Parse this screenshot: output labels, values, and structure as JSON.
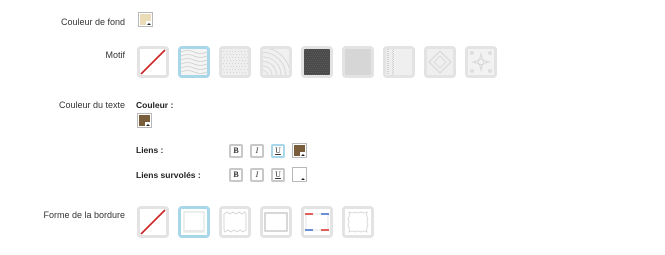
{
  "background": {
    "label": "Couleur de fond",
    "color": "#eadcb6"
  },
  "motif": {
    "label": "Motif",
    "selected_index": 1,
    "tiles": [
      {
        "name": "none",
        "icon": "none-slash-icon"
      },
      {
        "name": "pattern-1",
        "icon": "pattern-waves-icon"
      },
      {
        "name": "pattern-2",
        "icon": "pattern-dots-icon"
      },
      {
        "name": "pattern-3",
        "icon": "pattern-ripple-icon"
      },
      {
        "name": "pattern-4",
        "icon": "pattern-dark-icon"
      },
      {
        "name": "pattern-5",
        "icon": "pattern-grid-icon"
      },
      {
        "name": "pattern-6",
        "icon": "pattern-noise-icon"
      },
      {
        "name": "pattern-7",
        "icon": "pattern-diamond-icon"
      },
      {
        "name": "pattern-8",
        "icon": "pattern-floral-icon"
      }
    ]
  },
  "text_color": {
    "label": "Couleur du texte",
    "color_label": "Couleur :",
    "color": "#7a5e3c",
    "links_label": "Liens :",
    "links_color": "#7a5e3c",
    "links_format": {
      "bold": "B",
      "italic": "I",
      "underline": "U",
      "active": "underline"
    },
    "hover_label": "Liens survolés :",
    "hover_color": "#ffffff",
    "hover_format": {
      "bold": "B",
      "italic": "I",
      "underline": "U",
      "active": "none"
    }
  },
  "border": {
    "label": "Forme de la bordure",
    "selected_index": 1,
    "tiles": [
      {
        "name": "none",
        "icon": "none-slash-icon"
      },
      {
        "name": "shadow",
        "icon": "border-shadow-icon"
      },
      {
        "name": "torn",
        "icon": "border-torn-icon"
      },
      {
        "name": "frame",
        "icon": "border-frame-icon"
      },
      {
        "name": "tape",
        "icon": "border-tape-icon"
      },
      {
        "name": "stamp",
        "icon": "border-stamp-icon"
      }
    ]
  },
  "colors": {
    "selected_border": "#a9d7ea",
    "tile_border": "#e3e3e3",
    "slash": "#cc2222",
    "tape_red": "#e06060",
    "tape_blue": "#6a8fd8"
  }
}
